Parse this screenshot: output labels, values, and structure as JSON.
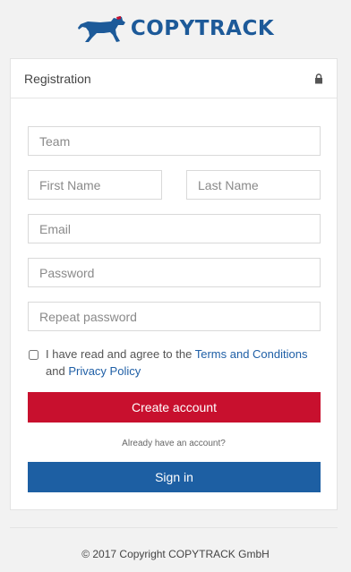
{
  "brand": {
    "name": "COPYTRACK",
    "color": "#1d5a99"
  },
  "card": {
    "title": "Registration"
  },
  "form": {
    "team_placeholder": "Team",
    "first_name_placeholder": "First Name",
    "last_name_placeholder": "Last Name",
    "email_placeholder": "Email",
    "password_placeholder": "Password",
    "repeat_password_placeholder": "Repeat password",
    "agree_prefix": "I have read and agree to the ",
    "terms_link": "Terms and Conditions",
    "agree_and": " and ",
    "privacy_link": "Privacy Policy"
  },
  "actions": {
    "create_label": "Create account",
    "already_text": "Already have an account?",
    "signin_label": "Sign in"
  },
  "footer": {
    "copyright": "© 2017 Copyright COPYTRACK GmbH"
  },
  "colors": {
    "create_button": "#c8102e",
    "signin_button": "#1d5fa3",
    "link": "#1f5fa6"
  }
}
